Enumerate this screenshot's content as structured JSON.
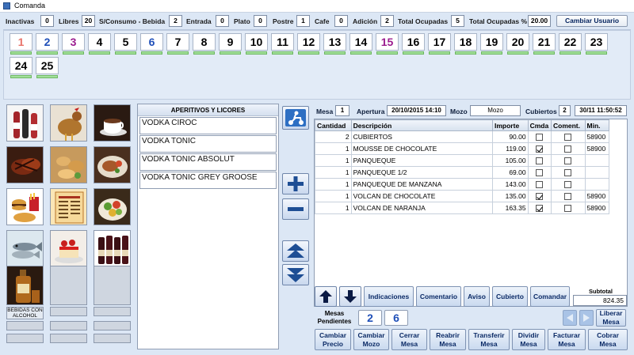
{
  "window": {
    "title": "Comanda"
  },
  "status": {
    "inactivas_label": "Inactivas",
    "inactivas_value": "0",
    "libres_label": "Libres",
    "libres_value": "20",
    "sconsumo_label": "S/Consumo - Bebida",
    "sconsumo_value": "2",
    "entrada_label": "Entrada",
    "entrada_value": "0",
    "plato_label": "Plato",
    "plato_value": "0",
    "postre_label": "Postre",
    "postre_value": "1",
    "cafe_label": "Cafe",
    "cafe_value": "0",
    "adicion_label": "Adición",
    "adicion_value": "2",
    "total_ocupadas_label": "Total Ocupadas",
    "total_ocupadas_value": "5",
    "total_ocupadas_pct_label": "Total Ocupadas %",
    "total_ocupadas_pct_value": "20.00",
    "cambiar_usuario": "Cambiar Usuario"
  },
  "tables": [
    {
      "n": "1",
      "color": "#e8736a"
    },
    {
      "n": "2",
      "color": "#1f4fb8"
    },
    {
      "n": "3",
      "color": "#9b1d8f"
    },
    {
      "n": "4",
      "color": "#000000"
    },
    {
      "n": "5",
      "color": "#000000"
    },
    {
      "n": "6",
      "color": "#1f4fb8"
    },
    {
      "n": "7",
      "color": "#000000"
    },
    {
      "n": "8",
      "color": "#000000"
    },
    {
      "n": "9",
      "color": "#000000"
    },
    {
      "n": "10",
      "color": "#000000"
    },
    {
      "n": "11",
      "color": "#000000"
    },
    {
      "n": "12",
      "color": "#000000"
    },
    {
      "n": "13",
      "color": "#000000"
    },
    {
      "n": "14",
      "color": "#000000"
    },
    {
      "n": "15",
      "color": "#9b1d8f"
    },
    {
      "n": "16",
      "color": "#000000"
    },
    {
      "n": "17",
      "color": "#000000"
    },
    {
      "n": "18",
      "color": "#000000"
    },
    {
      "n": "19",
      "color": "#000000"
    },
    {
      "n": "20",
      "color": "#000000"
    },
    {
      "n": "21",
      "color": "#000000"
    },
    {
      "n": "22",
      "color": "#000000"
    },
    {
      "n": "23",
      "color": "#000000"
    },
    {
      "n": "24",
      "color": "#000000"
    },
    {
      "n": "25",
      "color": "#000000"
    }
  ],
  "categories": {
    "bebidas_con_alcohol": "BEBIDAS CON ALCOHOL"
  },
  "product_list": {
    "header": "APERITIVOS Y LICORES",
    "items": [
      "VODKA CIROC",
      "VODKA TONIC",
      "VODKA TONIC ABSOLUT",
      "VODKA TONIC GREY GROOSE"
    ]
  },
  "order_info": {
    "mesa_label": "Mesa",
    "mesa_value": "1",
    "apertura_label": "Apertura",
    "apertura_value": "20/10/2015 14:10",
    "mozo_label": "Mozo",
    "mozo_value": "Mozo",
    "cubiertos_label": "Cubiertos",
    "cubiertos_value": "2",
    "datetime_value": "30/11 11:50:52"
  },
  "order_table": {
    "columns": [
      "Cantidad",
      "Descripción",
      "Importe",
      "Cmda",
      "Coment.",
      "Min."
    ],
    "rows": [
      {
        "cantidad": "2",
        "descripcion": "CUBIERTOS",
        "importe": "90.00",
        "cmda": false,
        "coment": false,
        "min": "58900"
      },
      {
        "cantidad": "1",
        "descripcion": "MOUSSE DE CHOCOLATE",
        "importe": "119.00",
        "cmda": true,
        "coment": false,
        "min": "58900"
      },
      {
        "cantidad": "1",
        "descripcion": "PANQUEQUE",
        "importe": "105.00",
        "cmda": false,
        "coment": false,
        "min": ""
      },
      {
        "cantidad": "1",
        "descripcion": "PANQUEQUE 1/2",
        "importe": "69.00",
        "cmda": false,
        "coment": false,
        "min": ""
      },
      {
        "cantidad": "1",
        "descripcion": "PANQUEQUE DE MANZANA",
        "importe": "143.00",
        "cmda": false,
        "coment": false,
        "min": ""
      },
      {
        "cantidad": "1",
        "descripcion": "VOLCAN DE CHOCOLATE",
        "importe": "135.00",
        "cmda": true,
        "coment": false,
        "min": "58900"
      },
      {
        "cantidad": "1",
        "descripcion": "VOLCAN DE NARANJA",
        "importe": "163.35",
        "cmda": true,
        "coment": false,
        "min": "58900"
      }
    ]
  },
  "actions1": {
    "indicaciones": "Indicaciones",
    "comentario": "Comentario",
    "aviso": "Aviso",
    "cubierto": "Cubierto",
    "comandar": "Comandar",
    "subtotal_label": "Subtotal",
    "subtotal_value": "824.35"
  },
  "pending": {
    "label": "Mesas Pendientes",
    "mesas": [
      "2",
      "6"
    ],
    "liberar_mesa": "Liberar Mesa"
  },
  "actions2": {
    "cambiar_precio": "Cambiar Precio",
    "cambiar_mozo": "Cambiar Mozo",
    "cerrar_mesa": "Cerrar Mesa",
    "reabrir_mesa": "Reabrir Mesa",
    "transferir_mesa": "Transferir Mesa",
    "dividir_mesa": "Dividir Mesa",
    "facturar_mesa": "Facturar Mesa",
    "cobrar_mesa": "Cobrar Mesa"
  }
}
